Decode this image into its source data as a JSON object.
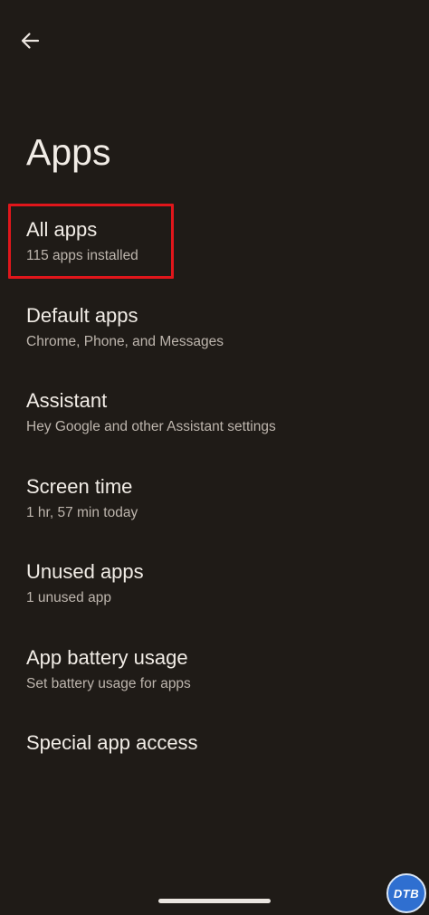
{
  "header": {
    "back_icon": "arrow-back-icon",
    "title": "Apps"
  },
  "items": [
    {
      "title": "All apps",
      "summary": "115 apps installed",
      "highlighted": true
    },
    {
      "title": "Default apps",
      "summary": "Chrome, Phone, and Messages"
    },
    {
      "title": "Assistant",
      "summary": "Hey Google and other Assistant settings"
    },
    {
      "title": "Screen time",
      "summary": "1 hr, 57 min today"
    },
    {
      "title": "Unused apps",
      "summary": "1 unused app"
    },
    {
      "title": "App battery usage",
      "summary": "Set battery usage for apps"
    },
    {
      "title": "Special app access"
    }
  ],
  "watermark": {
    "text": "DTB"
  },
  "colors": {
    "background": "#1f1b17",
    "highlight": "#e0161b",
    "watermark": "#2f6fd0"
  }
}
